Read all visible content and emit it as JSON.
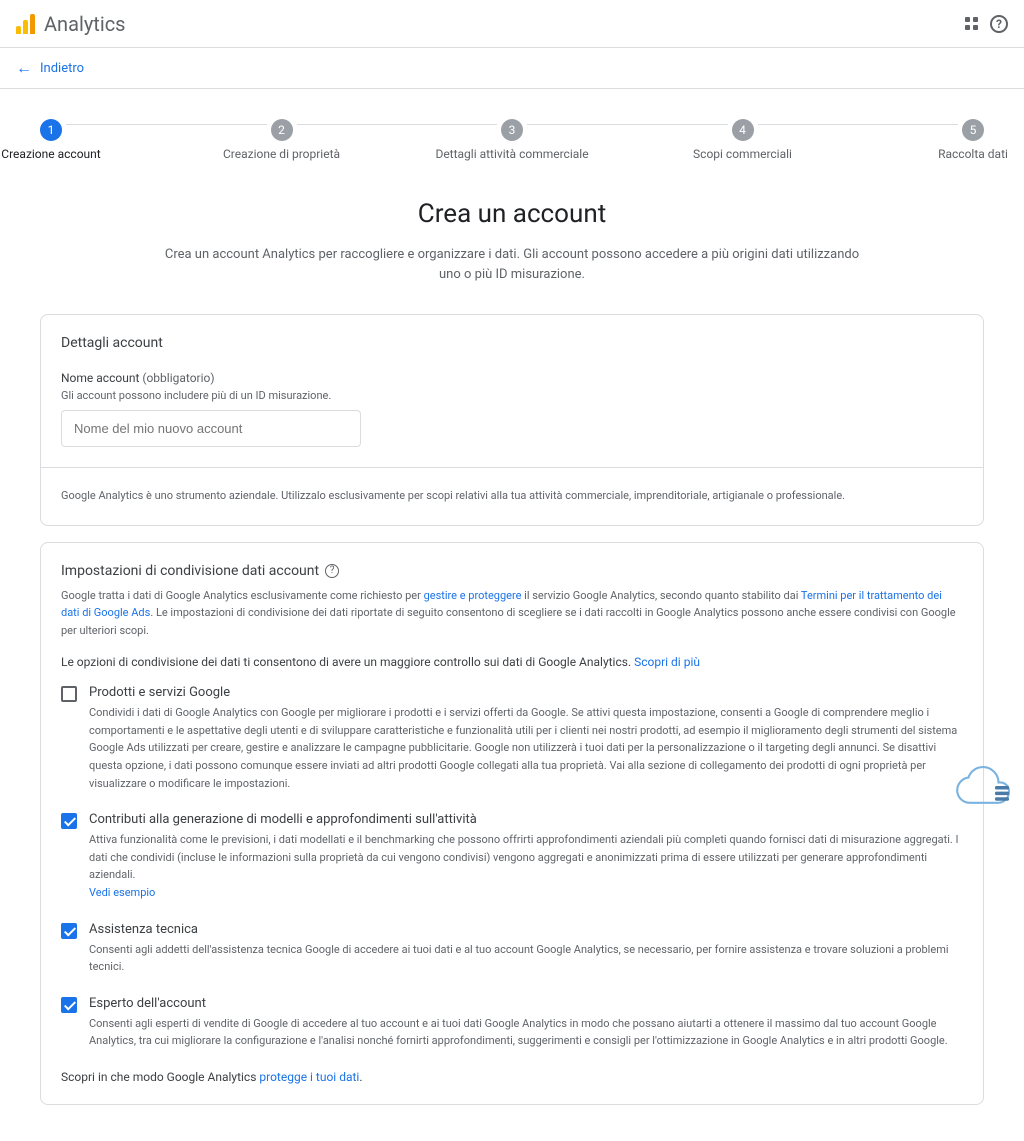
{
  "header": {
    "title": "Analytics"
  },
  "back": {
    "label": "Indietro"
  },
  "stepper": {
    "steps": [
      {
        "num": "1",
        "label": "Creazione account"
      },
      {
        "num": "2",
        "label": "Creazione di proprietà"
      },
      {
        "num": "3",
        "label": "Dettagli attività commerciale"
      },
      {
        "num": "4",
        "label": "Scopi commerciali"
      },
      {
        "num": "5",
        "label": "Raccolta dati"
      }
    ]
  },
  "page": {
    "title": "Crea un account",
    "subtitle": "Crea un account Analytics per raccogliere e organizzare i dati. Gli account possono accedere a più origini dati utilizzando uno o più ID misurazione."
  },
  "details": {
    "card_title": "Dettagli account",
    "field_label": "Nome account",
    "field_req": "(obbligatorio)",
    "field_hint": "Gli account possono includere più di un ID misurazione.",
    "placeholder": "Nome del mio nuovo account",
    "disclaimer": "Google Analytics è uno strumento aziendale. Utilizzalo esclusivamente per scopi relativi alla tua attività commerciale, imprenditoriale, artigianale o professionale."
  },
  "sharing": {
    "title": "Impostazioni di condivisione dati account",
    "desc_pre": "Google tratta i dati di Google Analytics esclusivamente come richiesto per ",
    "link1": "gestire e proteggere",
    "desc_mid": " il servizio Google Analytics, secondo quanto stabilito dai ",
    "link2": "Termini per il trattamento dei dati di Google Ads",
    "desc_post": ". Le impostazioni di condivisione dei dati riportate di seguito consentono di scegliere se i dati raccolti in Google Analytics possono anche essere condivisi con Google per ulteriori scopi.",
    "info_text_pre": "Le opzioni di condivisione dei dati ti consentono di avere un maggiore controllo sui dati di Google Analytics. ",
    "info_link": "Scopri di più",
    "options": [
      {
        "checked": false,
        "label": "Prodotti e servizi Google",
        "desc": "Condividi i dati di Google Analytics con Google per migliorare i prodotti e i servizi offerti da Google. Se attivi questa impostazione, consenti a Google di comprendere meglio i comportamenti e le aspettative degli utenti e di sviluppare caratteristiche e funzionalità utili per i clienti nei nostri prodotti, ad esempio il miglioramento degli strumenti del sistema Google Ads utilizzati per creare, gestire e analizzare le campagne pubblicitarie. Google non utilizzerà i tuoi dati per la personalizzazione o il targeting degli annunci. Se disattivi questa opzione, i dati possono comunque essere inviati ad altri prodotti Google collegati alla tua proprietà. Vai alla sezione di collegamento dei prodotti di ogni proprietà per visualizzare o modificare le impostazioni."
      },
      {
        "checked": true,
        "label": "Contributi alla generazione di modelli e approfondimenti sull'attività",
        "desc": "Attiva funzionalità come le previsioni, i dati modellati e il benchmarking che possono offrirti approfondimenti aziendali più completi quando fornisci dati di misurazione aggregati. I dati che condividi (incluse le informazioni sulla proprietà da cui vengono condivisi) vengono aggregati e anonimizzati prima di essere utilizzati per generare approfondimenti aziendali.",
        "link": "Vedi esempio"
      },
      {
        "checked": true,
        "label": "Assistenza tecnica",
        "desc": "Consenti agli addetti dell'assistenza tecnica Google di accedere ai tuoi dati e al tuo account Google Analytics, se necessario, per fornire assistenza e trovare soluzioni a problemi tecnici."
      },
      {
        "checked": true,
        "label": "Esperto dell'account",
        "desc": "Consenti agli esperti di vendite di Google di accedere al tuo account e ai tuoi dati Google Analytics in modo che possano aiutarti a ottenere il massimo dal tuo account Google Analytics, tra cui migliorare la configurazione e l'analisi nonché fornirti approfondimenti, suggerimenti e consigli per l'ottimizzazione in Google Analytics e in altri prodotti Google."
      }
    ],
    "footer_pre": "Scopri in che modo Google Analytics ",
    "footer_link": "protegge i tuoi dati",
    "footer_post": "."
  }
}
